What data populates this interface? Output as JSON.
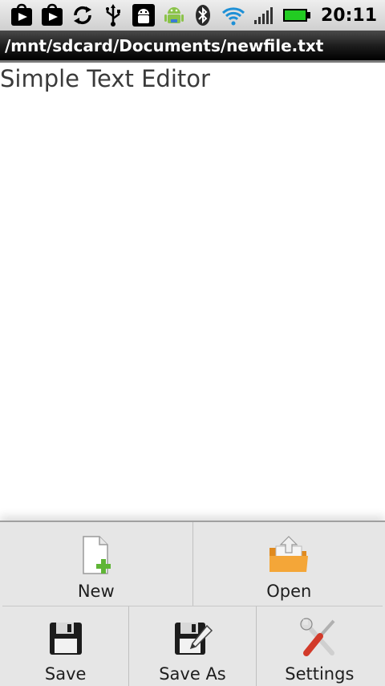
{
  "status_bar": {
    "icons": [
      "play-store-bag-icon",
      "play-store-bag-icon",
      "sync-icon",
      "usb-icon",
      "android-debug-icon",
      "android-robot-icon",
      "bluetooth-icon",
      "wifi-icon",
      "signal-icon",
      "battery-icon"
    ],
    "time": "20:11"
  },
  "title_bar": {
    "path": "/mnt/sdcard/Documents/newfile.txt"
  },
  "content": {
    "heading": "Simple Text Editor"
  },
  "menu": {
    "new_label": "New",
    "open_label": "Open",
    "save_label": "Save",
    "save_as_label": "Save As",
    "settings_label": "Settings"
  },
  "colors": {
    "title_bar": "#000000",
    "menu_background": "#e6e6e6",
    "battery_green": "#22cc22",
    "wifi_blue": "#1e90d6"
  }
}
